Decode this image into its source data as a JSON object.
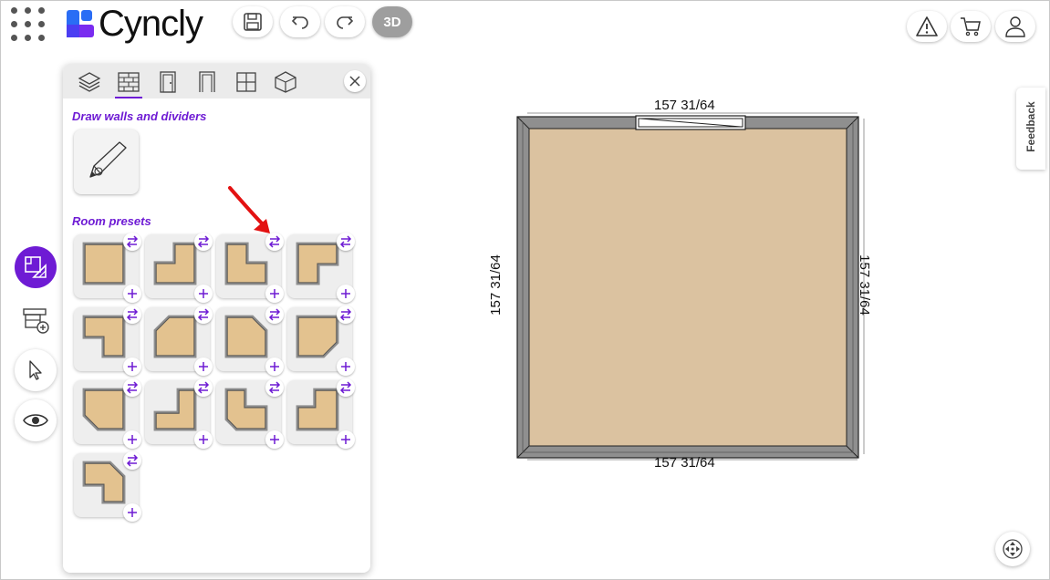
{
  "app": {
    "logo_text": "Cyncly"
  },
  "toolbar": {
    "view_3d_label": "3D"
  },
  "panel": {
    "draw_section_title": "Draw walls and dividers",
    "presets_section_title": "Room presets",
    "preset_count": 13,
    "tabs": [
      "layers-tab",
      "walls-tab",
      "doors-tab",
      "openings-tab",
      "windows-tab",
      "objects-tab"
    ]
  },
  "plan": {
    "top_dim": "157 31/64",
    "bottom_dim": "157 31/64",
    "left_dim": "157 31/64",
    "right_dim": "157 31/64"
  },
  "feedback": {
    "label": "Feedback"
  },
  "colors": {
    "accent": "#6e1bd4",
    "floor": "#dbc2a0",
    "wall": "#8f8f8f"
  }
}
